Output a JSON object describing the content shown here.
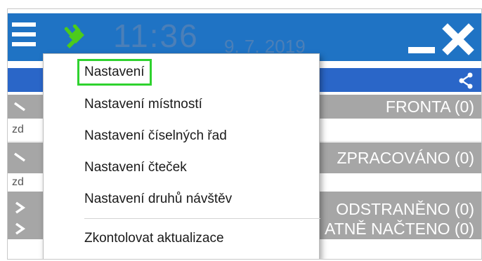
{
  "window": {
    "time": "11:36",
    "date": "9. 7. 2019"
  },
  "sections": [
    {
      "title": "FRONTA (0)",
      "filter_value": "zd"
    },
    {
      "title": "ZPRACOVÁNO (0)",
      "filter_value": "zd"
    },
    {
      "title": "ODSTRANĚNO (0)"
    },
    {
      "title": "ATNĚ NAČTENO (0)"
    }
  ],
  "menu": {
    "items": [
      {
        "label": "Nastavení",
        "highlighted": true
      },
      {
        "label": "Nastavení místností"
      },
      {
        "label": "Nastavení číselných řad"
      },
      {
        "label": "Nastavení čteček"
      },
      {
        "label": "Nastavení druhů návštěv"
      },
      {
        "label": "Zkontolovat aktualizace"
      }
    ]
  },
  "colors": {
    "titlebar": "#1f73c4",
    "toolbar": "#2a66c8",
    "section_header": "#a6a6a6",
    "plug_icon": "#4ccb1b",
    "highlight": "#2fd22f"
  }
}
